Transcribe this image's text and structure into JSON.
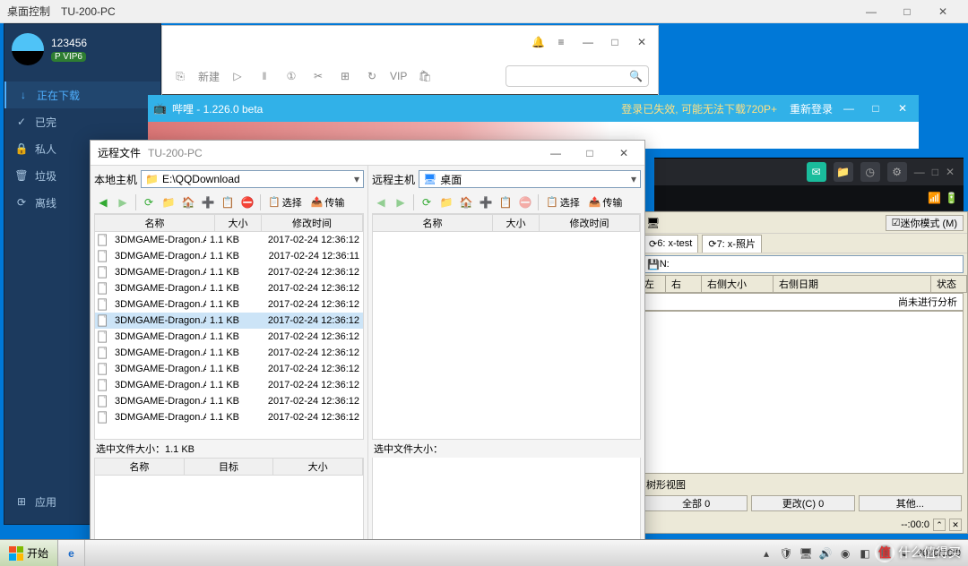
{
  "outer": {
    "title_left": "桌面控制",
    "title_host": "TU-200-PC"
  },
  "dlmgr": {
    "uid": "123456",
    "vip": "P VIP6",
    "nav": [
      {
        "icon": "↓",
        "label": "正在下载",
        "active": true
      },
      {
        "icon": "✓",
        "label": "已完",
        "active": false
      },
      {
        "icon": "🔒",
        "label": "私人",
        "active": false
      },
      {
        "icon": "🗑",
        "label": "垃圾",
        "active": false
      },
      {
        "icon": "⟳",
        "label": "离线",
        "active": false
      }
    ],
    "bottom": {
      "icon": "⊞",
      "label": "应用"
    }
  },
  "browser": {
    "newtab": "新建",
    "label_vip": "VIP",
    "top_icons": [
      "🔔",
      "≡",
      "—",
      "□",
      "✕"
    ]
  },
  "bili": {
    "app_icon": "📺",
    "title": "哔哩 - 1.226.0 beta",
    "msg": "登录已失效, 可能无法下载720P+",
    "relogin": "重新登录"
  },
  "beige": {
    "mini_mode": "迷你模式 (M)",
    "tabs": [
      "6: x-test",
      "7: x-照片"
    ],
    "drive_icon": "💾",
    "drive": "N:",
    "cols": [
      "左",
      "右",
      "右侧大小",
      "右侧日期",
      "状态"
    ],
    "status": "尚未进行分析",
    "tree_label": "树形视图",
    "tree_btns": [
      "全部  0",
      "更改(C)  0",
      "其他..."
    ],
    "time": "--:00:0"
  },
  "ft": {
    "title": "远程文件",
    "host": "TU-200-PC",
    "left": {
      "host_label": "本地主机",
      "path": "E:\\QQDownload",
      "icon": "📁",
      "sel_label": "选中文件大小：",
      "sel_size": "1.1 KB",
      "queue_cols": [
        "名称",
        "目标",
        "大小"
      ],
      "cols": {
        "name": "名称",
        "size": "大小",
        "mtime": "修改时间"
      },
      "col_w": {
        "name": 120,
        "size": 52,
        "mtime": 120
      },
      "files": [
        {
          "name": "3DMGAME-Dragon.A",
          "size": "1.1 KB",
          "mtime": "2017-02-24 12:36:12",
          "sel": false
        },
        {
          "name": "3DMGAME-Dragon.A",
          "size": "1.1 KB",
          "mtime": "2017-02-24 12:36:11",
          "sel": false
        },
        {
          "name": "3DMGAME-Dragon.A",
          "size": "1.1 KB",
          "mtime": "2017-02-24 12:36:12",
          "sel": false
        },
        {
          "name": "3DMGAME-Dragon.A",
          "size": "1.1 KB",
          "mtime": "2017-02-24 12:36:12",
          "sel": false
        },
        {
          "name": "3DMGAME-Dragon.A",
          "size": "1.1 KB",
          "mtime": "2017-02-24 12:36:12",
          "sel": false
        },
        {
          "name": "3DMGAME-Dragon.A",
          "size": "1.1 KB",
          "mtime": "2017-02-24 12:36:12",
          "sel": true
        },
        {
          "name": "3DMGAME-Dragon.A",
          "size": "1.1 KB",
          "mtime": "2017-02-24 12:36:12",
          "sel": false
        },
        {
          "name": "3DMGAME-Dragon.A",
          "size": "1.1 KB",
          "mtime": "2017-02-24 12:36:12",
          "sel": false
        },
        {
          "name": "3DMGAME-Dragon.A",
          "size": "1.1 KB",
          "mtime": "2017-02-24 12:36:12",
          "sel": false
        },
        {
          "name": "3DMGAME-Dragon.A",
          "size": "1.1 KB",
          "mtime": "2017-02-24 12:36:12",
          "sel": false
        },
        {
          "name": "3DMGAME-Dragon.A",
          "size": "1.1 KB",
          "mtime": "2017-02-24 12:36:12",
          "sel": false
        },
        {
          "name": "3DMGAME-Dragon.A",
          "size": "1.1 KB",
          "mtime": "2017-02-24 12:36:12",
          "sel": false
        }
      ]
    },
    "right": {
      "host_label": "远程主机",
      "path": "桌面",
      "icon": "🖥",
      "sel_label": "选中文件大小：",
      "cols": {
        "name": "名称",
        "size": "大小",
        "mtime": "修改时间"
      },
      "col_w": {
        "name": 120,
        "size": 52,
        "mtime": 120
      },
      "files": []
    },
    "iconbar_btns": {
      "select": "选择",
      "transfer": "传输"
    }
  },
  "taskbar": {
    "start": "开始",
    "date": "2020/10/9"
  },
  "watermark": "什么值得买"
}
